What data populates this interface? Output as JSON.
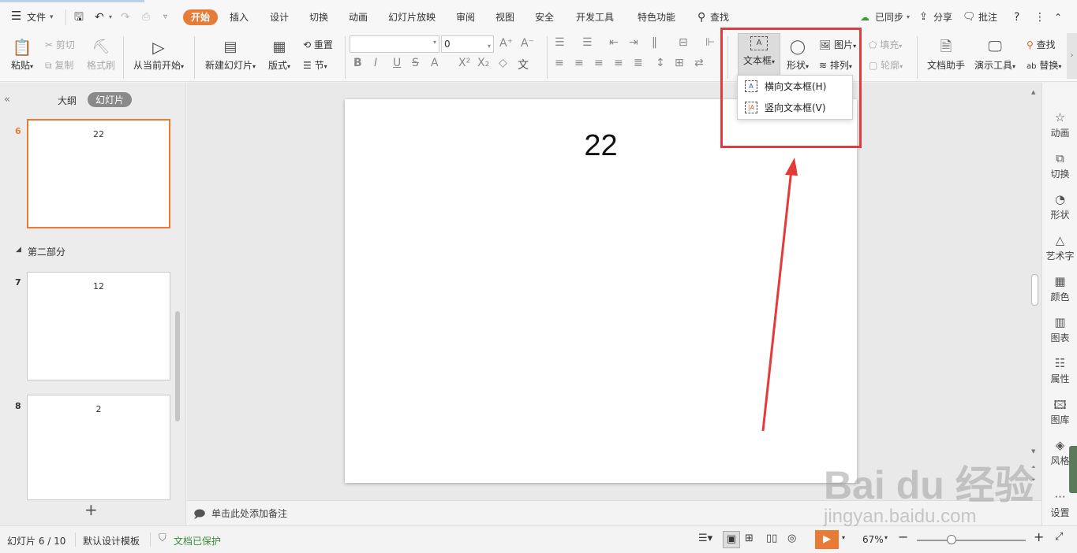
{
  "menubar": {
    "file_label": "文件",
    "tabs": [
      "开始",
      "插入",
      "设计",
      "切换",
      "动画",
      "幻灯片放映",
      "审阅",
      "视图",
      "安全",
      "开发工具",
      "特色功能"
    ],
    "search_label": "查找",
    "sync_label": "已同步",
    "share_label": "分享",
    "comment_label": "批注"
  },
  "ribbon": {
    "paste": "粘贴",
    "cut": "剪切",
    "copy": "复制",
    "format_painter": "格式刷",
    "from_current": "从当前开始",
    "new_slide": "新建幻灯片",
    "layout": "版式",
    "reset": "重置",
    "section": "节",
    "font_size": "0",
    "textbox": "文本框",
    "shape": "形状",
    "picture": "图片",
    "arrange": "排列",
    "fill": "填充",
    "outline": "轮廓",
    "doc_helper": "文档助手",
    "presenter_tools": "演示工具",
    "find": "查找",
    "replace": "替换"
  },
  "dropdown": {
    "items": [
      "横向文本框(H)",
      "竖向文本框(V)"
    ]
  },
  "leftpane": {
    "tab_outline": "大纲",
    "tab_slides": "幻灯片",
    "section_label": "第二部分",
    "slides": [
      {
        "num": "6",
        "text": "22"
      },
      {
        "num": "7",
        "text": "12"
      },
      {
        "num": "8",
        "text": "2"
      }
    ]
  },
  "slide": {
    "title": "22"
  },
  "notes": {
    "placeholder": "单击此处添加备注"
  },
  "rightpane": {
    "items": [
      "动画",
      "切换",
      "形状",
      "艺术字",
      "颜色",
      "图表",
      "属性",
      "图库",
      "风格",
      "设置"
    ]
  },
  "status": {
    "slide_info": "幻灯片 6 / 10",
    "template": "默认设计模板",
    "protected": "文档已保护",
    "zoom": "67%"
  },
  "watermark": {
    "brand": "Bai du 经验",
    "url": "jingyan.baidu.com"
  },
  "colors": {
    "accent": "#e87b35",
    "highlight": "#e53a3a",
    "arrow": "#e53a3a"
  }
}
